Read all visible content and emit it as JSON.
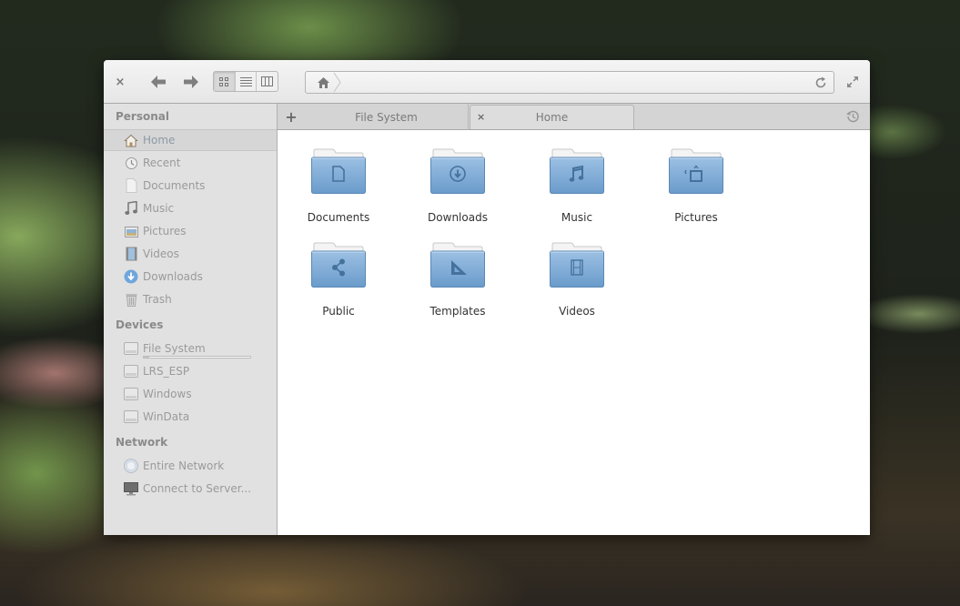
{
  "toolbar": {
    "close": "×",
    "view_modes": [
      "icon-view",
      "list-view",
      "column-view"
    ],
    "active_view": "icon-view",
    "path": {
      "location": "Home",
      "text": ""
    }
  },
  "sidebar": {
    "sections": [
      {
        "header": "Personal",
        "items": [
          {
            "label": "Home",
            "icon": "home-icon",
            "selected": true
          },
          {
            "label": "Recent",
            "icon": "recent-icon"
          },
          {
            "label": "Documents",
            "icon": "document-icon"
          },
          {
            "label": "Music",
            "icon": "music-icon"
          },
          {
            "label": "Pictures",
            "icon": "pictures-icon"
          },
          {
            "label": "Videos",
            "icon": "videos-icon"
          },
          {
            "label": "Downloads",
            "icon": "downloads-icon"
          },
          {
            "label": "Trash",
            "icon": "trash-icon"
          }
        ]
      },
      {
        "header": "Devices",
        "items": [
          {
            "label": "File System",
            "icon": "drive-icon",
            "usage_fraction": 0.05
          },
          {
            "label": "LRS_ESP",
            "icon": "drive-icon"
          },
          {
            "label": "Windows",
            "icon": "drive-icon"
          },
          {
            "label": "WinData",
            "icon": "drive-icon"
          }
        ]
      },
      {
        "header": "Network",
        "items": [
          {
            "label": "Entire Network",
            "icon": "network-icon"
          },
          {
            "label": "Connect to Server...",
            "icon": "server-icon"
          }
        ]
      }
    ]
  },
  "tabs": {
    "new_tab": "+",
    "items": [
      {
        "label": "File System",
        "active": false
      },
      {
        "label": "Home",
        "active": true,
        "close": "×"
      }
    ]
  },
  "folders": [
    {
      "label": "Documents",
      "emblem": "document"
    },
    {
      "label": "Downloads",
      "emblem": "download"
    },
    {
      "label": "Music",
      "emblem": "music"
    },
    {
      "label": "Pictures",
      "emblem": "picture"
    },
    {
      "label": "Public",
      "emblem": "share"
    },
    {
      "label": "Templates",
      "emblem": "template"
    },
    {
      "label": "Videos",
      "emblem": "video"
    }
  ],
  "colors": {
    "folder_blue": "#7aa8d4",
    "folder_emblem": "#3f6d99",
    "sidebar_bg": "#e1e1e1",
    "sidebar_text": "#9a9a9a"
  }
}
